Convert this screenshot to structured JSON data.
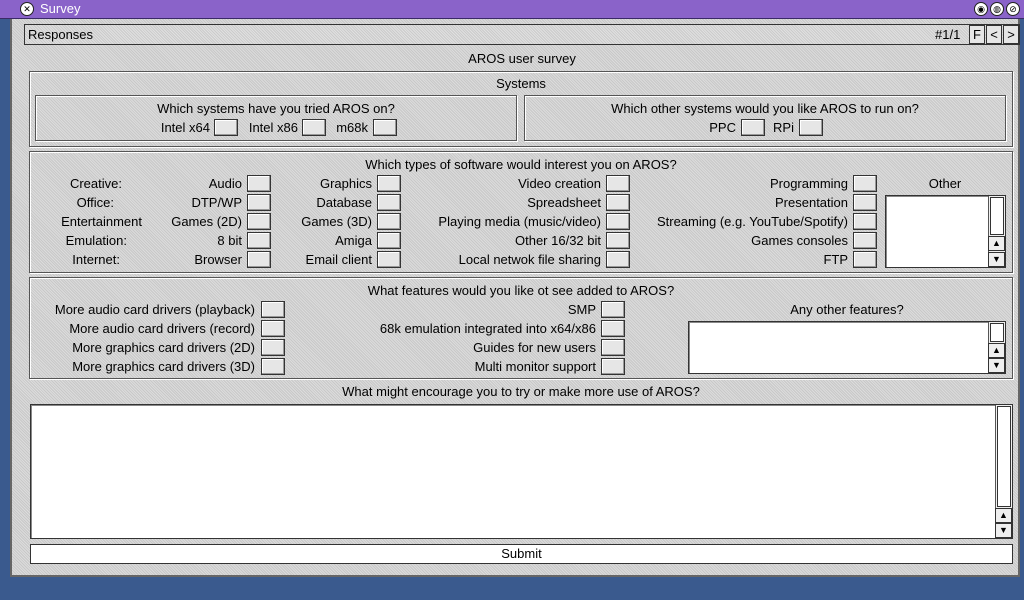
{
  "window": {
    "title": "Survey"
  },
  "header": {
    "title": "Responses",
    "page_indicator": "#1/1",
    "btn_f": "F",
    "btn_prev": "<",
    "btn_next": ">"
  },
  "survey_title": "AROS user survey",
  "systems": {
    "title": "Systems",
    "tried": {
      "question": "Which systems have you tried AROS on?",
      "options": [
        "Intel x64",
        "Intel x86",
        "m68k"
      ]
    },
    "wanted": {
      "question": "Which other systems would you like AROS to run on?",
      "options": [
        "PPC",
        "RPi"
      ]
    }
  },
  "software": {
    "question": "Which types of software would interest you on AROS?",
    "other_label": "Other",
    "rows": [
      {
        "category": "Creative:",
        "items": [
          "Audio",
          "Graphics",
          "Video creation",
          "Programming"
        ]
      },
      {
        "category": "Office:",
        "items": [
          "DTP/WP",
          "Database",
          "Spreadsheet",
          "Presentation"
        ]
      },
      {
        "category": "Entertainment",
        "items": [
          "Games (2D)",
          "Games (3D)",
          "Playing media (music/video)",
          "Streaming (e.g. YouTube/Spotify)"
        ]
      },
      {
        "category": "Emulation:",
        "items": [
          "8 bit",
          "Amiga",
          "Other 16/32 bit",
          "Games consoles"
        ]
      },
      {
        "category": "Internet:",
        "items": [
          "Browser",
          "Email client",
          "Local netwok file sharing",
          "FTP"
        ]
      }
    ]
  },
  "features": {
    "question": "What features would you like ot see added to AROS?",
    "left": [
      "More audio card drivers (playback)",
      "More audio card drivers (record)",
      "More graphics card drivers (2D)",
      "More graphics card drivers (3D)"
    ],
    "right": [
      "SMP",
      "68k emulation integrated into x64/x86",
      "Guides for new users",
      "Multi monitor support"
    ],
    "other_label": "Any other features?"
  },
  "encourage": {
    "question": "What might encourage you to try or make more use of AROS?"
  },
  "submit_label": "Submit",
  "icons": {
    "up": "up-arrow-icon",
    "down": "down-arrow-icon",
    "close": "close-icon"
  }
}
